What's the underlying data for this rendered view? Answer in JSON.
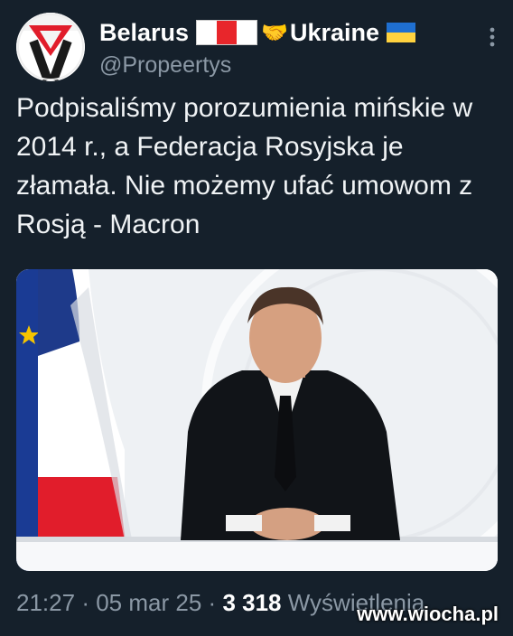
{
  "author": {
    "display_name": "Belarus",
    "suffix_name": "Ukraine",
    "handle": "@Propeertys",
    "belarus_flag_colors": [
      "#ffffff",
      "#e8262b",
      "#ffffff"
    ],
    "handshake_icon": "handshake-emoji",
    "ukraine_flag_colors": [
      "#1f6fd0",
      "#ffd23f"
    ]
  },
  "tweet": {
    "text": "Podpisaliśmy porozumienia mińskie w 2014 r., a Federacja Rosyjska je złamała. Nie możemy ufać umowom z Rosją - Macron"
  },
  "media": {
    "description_icon": "press-conference-photo",
    "flag_colors": [
      "#1e3a8a",
      "#ffffff",
      "#e11d2b"
    ],
    "eu_flag_color": "#1a3b94"
  },
  "footer": {
    "time": "21:27",
    "separator": "·",
    "date": "05 mar 25",
    "views": "3 318",
    "views_label": "Wyświetlenia"
  },
  "watermark": {
    "text": "www.wiocha.pl"
  }
}
